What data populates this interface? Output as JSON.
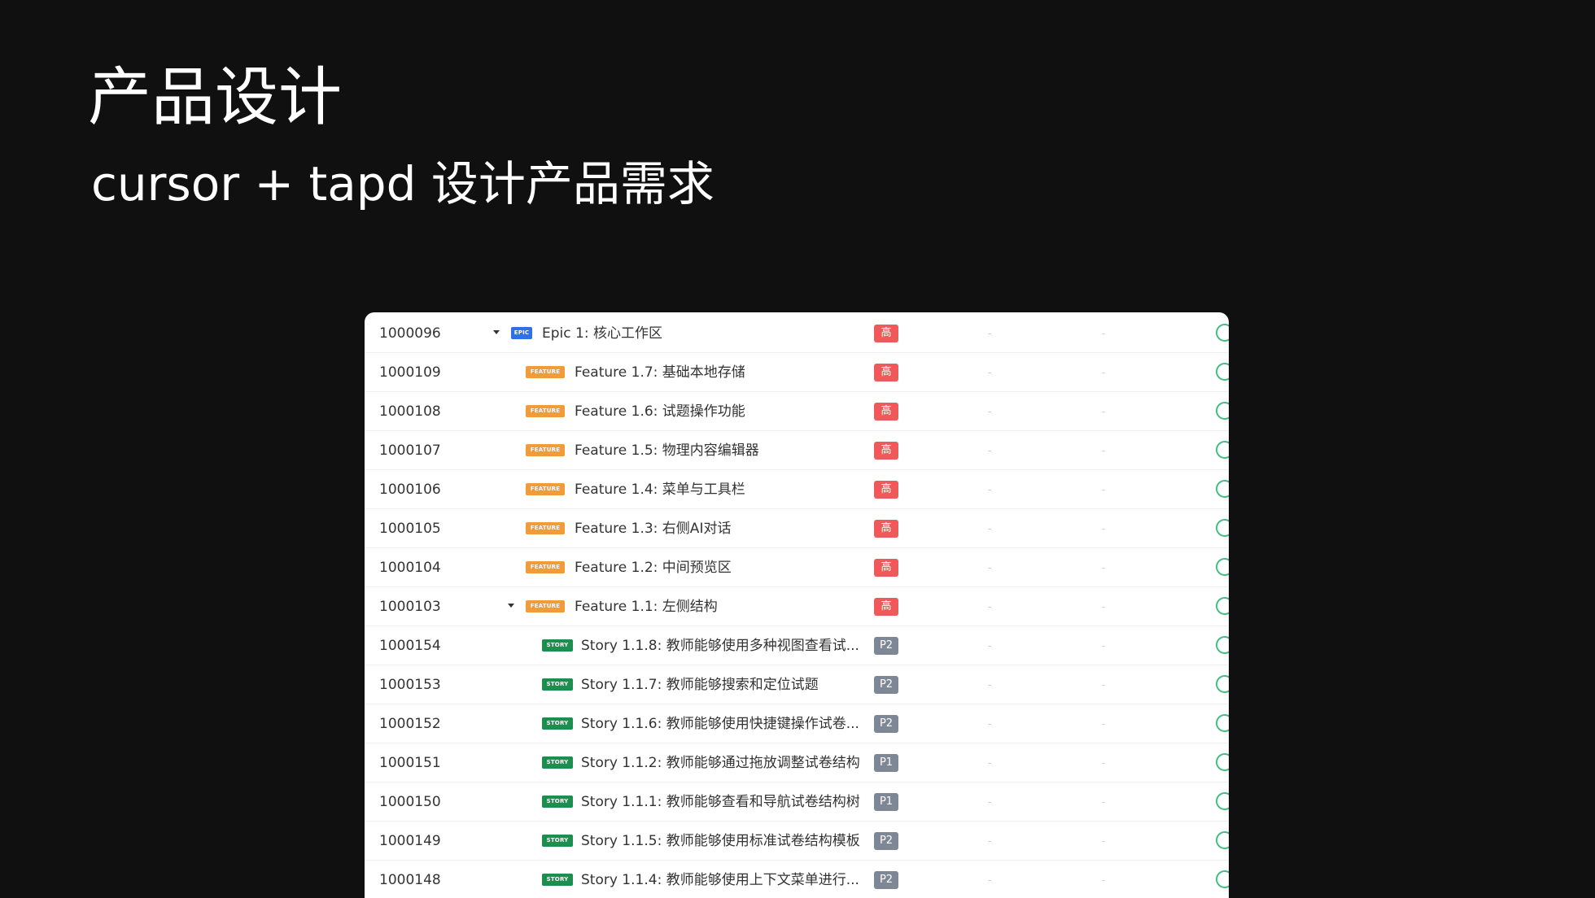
{
  "slide": {
    "title": "产品设计",
    "subtitle": "cursor + tapd 设计产品需求"
  },
  "colors": {
    "background": "#101010",
    "epic_tag": "#2f6fe8",
    "feature_tag": "#f29b38",
    "story_tag": "#1a8f4e",
    "priority_high": "#ee5a5a",
    "priority_p": "#7d8796",
    "status_ring": "#3fbf7f"
  },
  "tags": {
    "epic": "EPIC",
    "feature": "FEATURE",
    "story": "STORY"
  },
  "placeholder": "-",
  "rows": [
    {
      "id": "1000096",
      "type": "epic",
      "level": 0,
      "expanded": true,
      "title": "Epic 1: 核心工作区",
      "priority": "高"
    },
    {
      "id": "1000109",
      "type": "feature",
      "level": 1,
      "expanded": false,
      "title": "Feature 1.7: 基础本地存储",
      "priority": "高"
    },
    {
      "id": "1000108",
      "type": "feature",
      "level": 1,
      "expanded": false,
      "title": "Feature 1.6: 试题操作功能",
      "priority": "高"
    },
    {
      "id": "1000107",
      "type": "feature",
      "level": 1,
      "expanded": false,
      "title": "Feature 1.5: 物理内容编辑器",
      "priority": "高"
    },
    {
      "id": "1000106",
      "type": "feature",
      "level": 1,
      "expanded": false,
      "title": "Feature 1.4: 菜单与工具栏",
      "priority": "高"
    },
    {
      "id": "1000105",
      "type": "feature",
      "level": 1,
      "expanded": false,
      "title": "Feature 1.3: 右侧AI对话",
      "priority": "高"
    },
    {
      "id": "1000104",
      "type": "feature",
      "level": 1,
      "expanded": false,
      "title": "Feature 1.2: 中间预览区",
      "priority": "高"
    },
    {
      "id": "1000103",
      "type": "feature",
      "level": 1,
      "expanded": true,
      "title": "Feature 1.1: 左侧结构",
      "priority": "高"
    },
    {
      "id": "1000154",
      "type": "story",
      "level": 2,
      "expanded": false,
      "title": "Story 1.1.8: 教师能够使用多种视图查看试...",
      "priority": "P2"
    },
    {
      "id": "1000153",
      "type": "story",
      "level": 2,
      "expanded": false,
      "title": "Story 1.1.7: 教师能够搜索和定位试题",
      "priority": "P2"
    },
    {
      "id": "1000152",
      "type": "story",
      "level": 2,
      "expanded": false,
      "title": "Story 1.1.6: 教师能够使用快捷键操作试卷...",
      "priority": "P2"
    },
    {
      "id": "1000151",
      "type": "story",
      "level": 2,
      "expanded": false,
      "title": "Story 1.1.2: 教师能够通过拖放调整试卷结构",
      "priority": "P1"
    },
    {
      "id": "1000150",
      "type": "story",
      "level": 2,
      "expanded": false,
      "title": "Story 1.1.1: 教师能够查看和导航试卷结构树",
      "priority": "P1"
    },
    {
      "id": "1000149",
      "type": "story",
      "level": 2,
      "expanded": false,
      "title": "Story 1.1.5: 教师能够使用标准试卷结构模板",
      "priority": "P2"
    },
    {
      "id": "1000148",
      "type": "story",
      "level": 2,
      "expanded": false,
      "title": "Story 1.1.4: 教师能够使用上下文菜单进行...",
      "priority": "P2"
    }
  ]
}
